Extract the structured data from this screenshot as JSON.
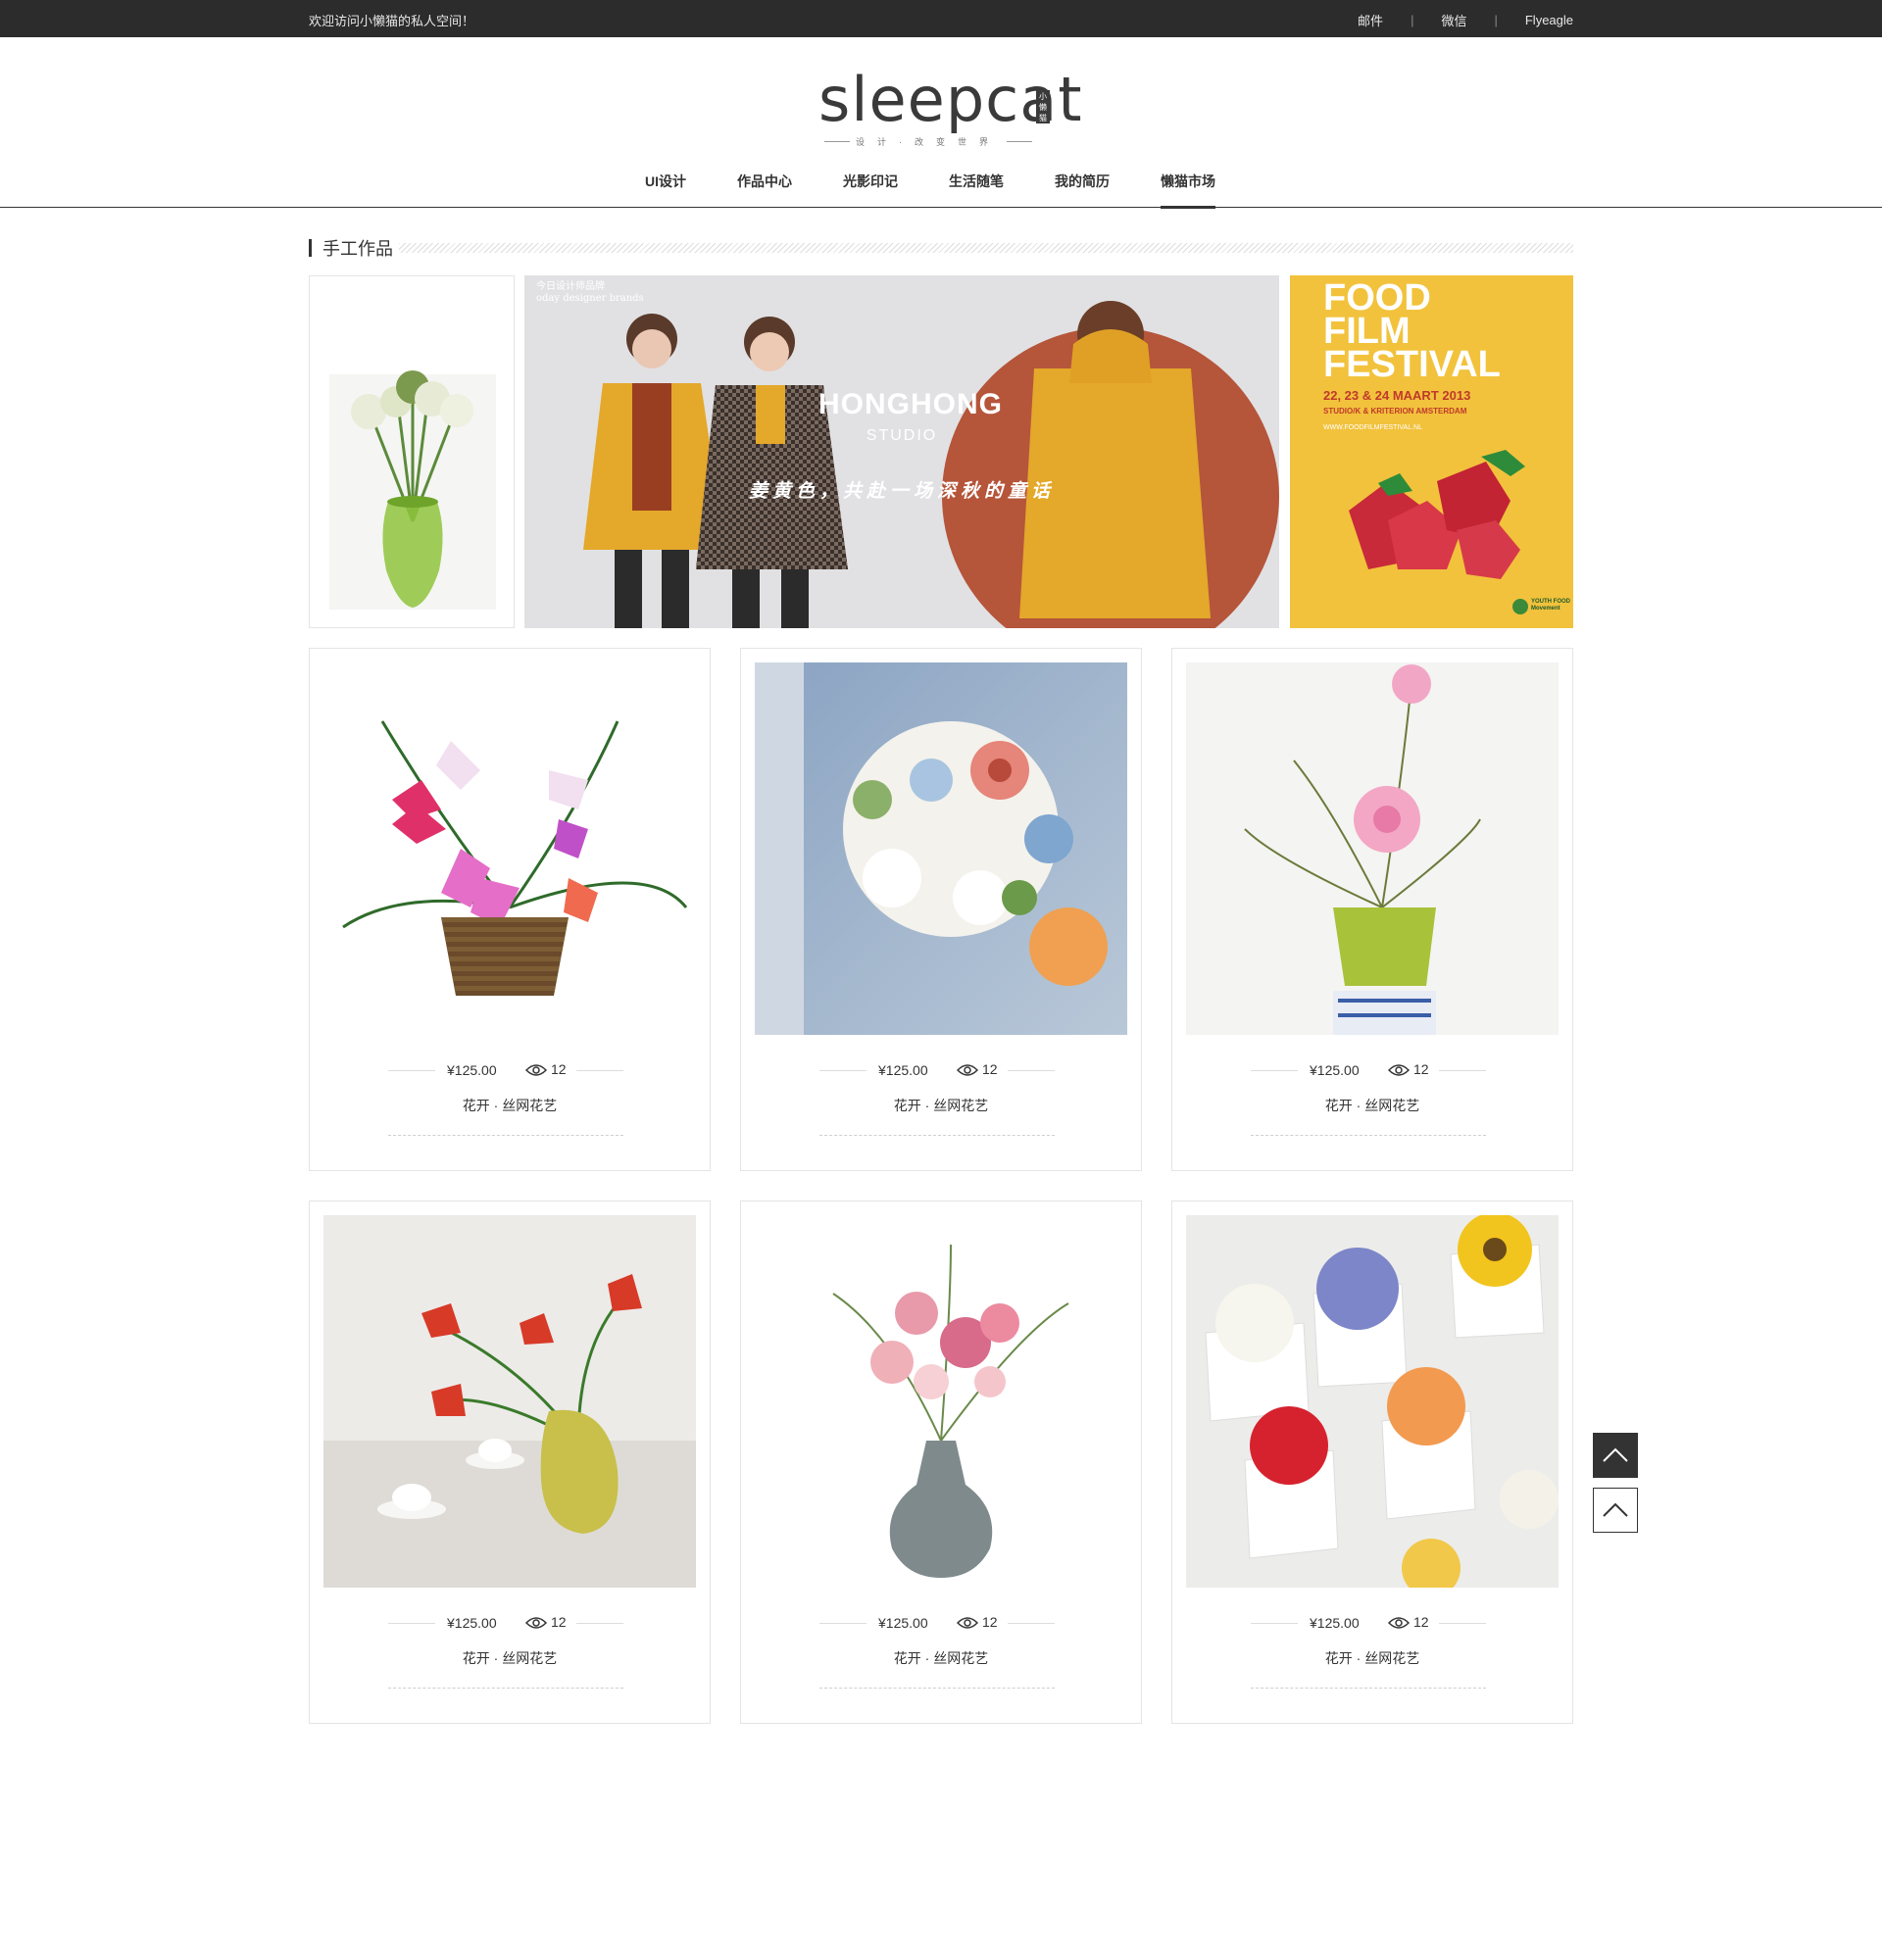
{
  "topbar": {
    "welcome": "欢迎访问小懒猫的私人空间！",
    "links": [
      "邮件",
      "微信",
      "Flyeagle"
    ],
    "separator": "|"
  },
  "logo": {
    "word": "sleepcat",
    "badge": "小懒猫",
    "tagline": "设计·改变世界"
  },
  "nav": {
    "items": [
      "UI设计",
      "作品中心",
      "光影印记",
      "生活随笔",
      "我的简历",
      "懒猫市场"
    ],
    "active_index": 5
  },
  "section": {
    "title": "手工作品"
  },
  "banners": {
    "middle": {
      "watermark_line1": "今日设计师品牌",
      "watermark_line2": "oday designer brands",
      "title": "HONGHONG",
      "subtitle": "STUDIO",
      "slogan": "姜黄色，共赴一场深秋的童话"
    },
    "right": {
      "line1": "FOOD",
      "line2": "FILM",
      "line3": "FESTIVAL",
      "dates": "22, 23 & 24 MAART 2013",
      "venue": "STUDIO/K & KRITERION AMSTERDAM",
      "url": "WWW.FOODFILMFESTIVAL.NL",
      "logo_text": "YOUTH FOOD Movement"
    }
  },
  "products": [
    {
      "price": "¥125.00",
      "views": "12",
      "title": "花开 · 丝网花艺"
    },
    {
      "price": "¥125.00",
      "views": "12",
      "title": "花开 · 丝网花艺"
    },
    {
      "price": "¥125.00",
      "views": "12",
      "title": "花开 · 丝网花艺"
    },
    {
      "price": "¥125.00",
      "views": "12",
      "title": "花开 · 丝网花艺"
    },
    {
      "price": "¥125.00",
      "views": "12",
      "title": "花开 · 丝网花艺"
    },
    {
      "price": "¥125.00",
      "views": "12",
      "title": "花开 · 丝网花艺"
    }
  ],
  "colors": {
    "topbar_bg": "#2c2c2c",
    "text": "#333333",
    "coat_yellow": "#e4a82a",
    "festival_yellow": "#f2c23c",
    "circle_rust": "#b5553a"
  },
  "icons": {
    "view": "eye-icon",
    "back_to_top": "chevron-up-icon"
  }
}
